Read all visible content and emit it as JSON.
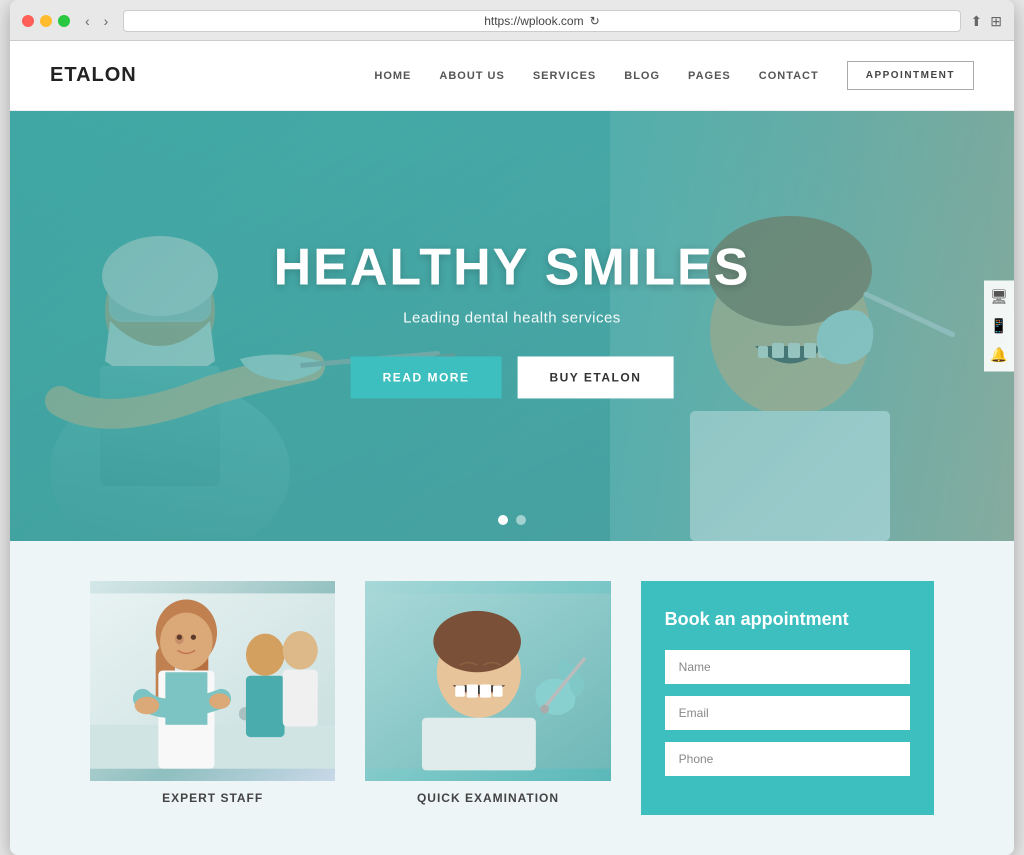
{
  "browser": {
    "url": "https://wplook.com",
    "refresh_icon": "↻"
  },
  "header": {
    "logo": "ETALON",
    "nav": {
      "home": "HOME",
      "about": "ABOUT US",
      "services": "SERVICES",
      "blog": "BLOG",
      "pages": "PAGES",
      "contact": "CONTACT",
      "appointment": "APPOINTMENT"
    }
  },
  "hero": {
    "title": "HEALTHY SMILES",
    "subtitle": "Leading dental health services",
    "btn_primary": "READ MORE",
    "btn_secondary": "BUY ETALON"
  },
  "cards": {
    "card1": {
      "label": "EXPERT STAFF"
    },
    "card2": {
      "label": "QUICK EXAMINATION"
    },
    "appointment": {
      "title": "Book an appointment",
      "name_placeholder": "Name",
      "email_placeholder": "Email",
      "phone_placeholder": "Phone"
    }
  }
}
